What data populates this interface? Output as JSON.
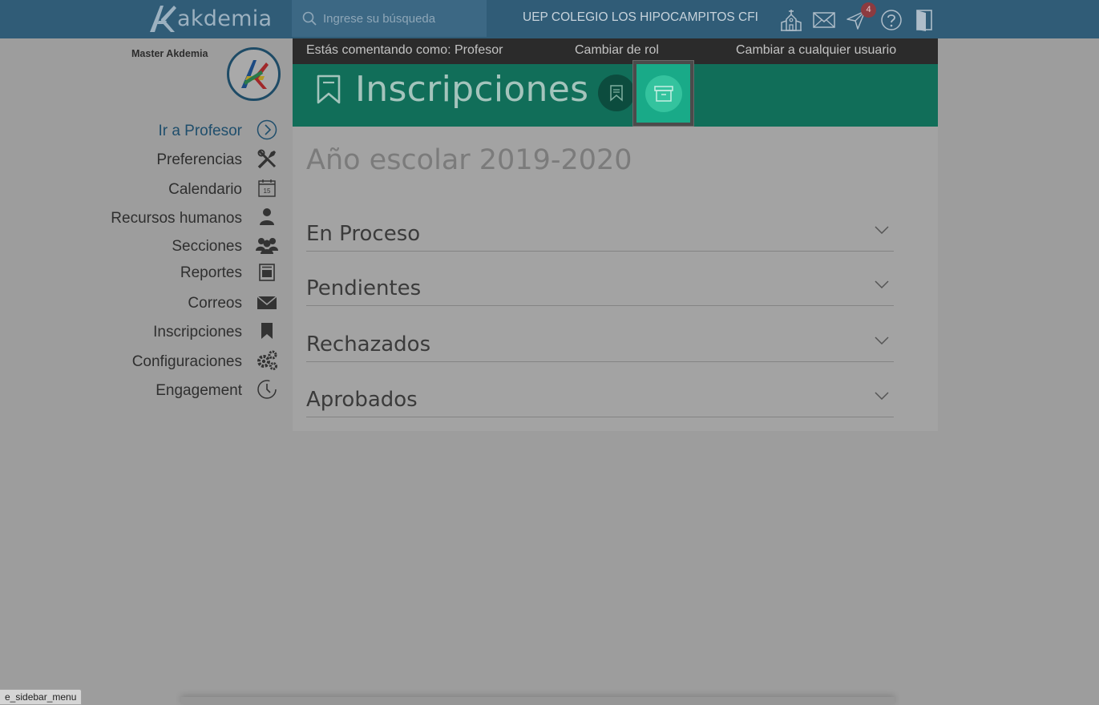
{
  "brand": {
    "name": "akdemia"
  },
  "search": {
    "placeholder": "Ingrese su búsqueda"
  },
  "school": {
    "name": "UEP COLEGIO LOS HIPOCAMPITOS CFI"
  },
  "notifications": {
    "count": "4"
  },
  "user": {
    "name": "Master Akdemia"
  },
  "sidebar": {
    "items": [
      {
        "label": "Ir a Profesor",
        "icon": "arrow-circle-right-icon"
      },
      {
        "label": "Preferencias",
        "icon": "tools-icon"
      },
      {
        "label": "Calendario",
        "icon": "calendar-icon",
        "day": "15"
      },
      {
        "label": "Recursos humanos",
        "icon": "person-icon"
      },
      {
        "label": "Secciones",
        "icon": "group-icon"
      },
      {
        "label": "Reportes",
        "icon": "report-icon"
      },
      {
        "label": "Correos",
        "icon": "envelope-icon"
      },
      {
        "label": "Inscripciones",
        "icon": "bookmark-icon"
      },
      {
        "label": "Configuraciones",
        "icon": "gears-icon"
      },
      {
        "label": "Engagement",
        "icon": "timer-icon"
      }
    ]
  },
  "rolebar": {
    "commenting_as": "Estás comentando como: Profesor",
    "change_role": "Cambiar de rol",
    "change_user": "Cambiar a cualquier usuario"
  },
  "header": {
    "title": "Inscripciones"
  },
  "main": {
    "school_year": "Año escolar 2019-2020",
    "sections": [
      {
        "label": "En Proceso"
      },
      {
        "label": "Pendientes"
      },
      {
        "label": "Rechazados"
      },
      {
        "label": "Aprobados"
      }
    ]
  },
  "status_bar": {
    "text": "e_sidebar_menu"
  },
  "colors": {
    "topbar": "#305c77",
    "header": "#116e59",
    "active_button": "#19aa88",
    "rolebar": "#2b2b2b",
    "overlay_background": "#9d9d9d"
  }
}
